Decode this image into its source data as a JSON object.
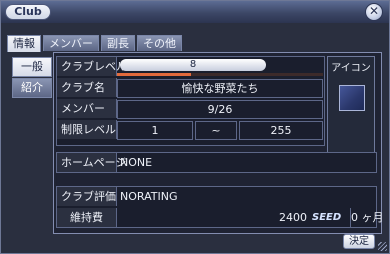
{
  "window": {
    "title": "Club",
    "close_glyph": "✕"
  },
  "tabs": [
    "情報",
    "メンバー",
    "副長",
    "その他"
  ],
  "side_tabs": [
    "一般",
    "紹介"
  ],
  "info": {
    "level_label": "クラブレベル",
    "level_value": "8",
    "xp_progress": 0.36,
    "name_label": "クラブ名",
    "name_value": "愉快な野菜たち",
    "members_label": "メンバー",
    "members_value": "9/26",
    "limit_label": "制限レベル",
    "limit_min": "1",
    "limit_sep": "~",
    "limit_max": "255",
    "homepage_label": "ホームページ",
    "homepage_value": "NONE",
    "rating_label": "クラブ評価",
    "rating_value": "NORATING",
    "upkeep_label": "維持費",
    "upkeep_amount": "2400",
    "upkeep_currency": "SEED",
    "upkeep_months": "0 ヶ月"
  },
  "icon_panel": {
    "label": "アイコン"
  },
  "ok_label": "決定",
  "colors": {
    "xp_bar": "#e26a3c",
    "window_bg": "#2a2f3f"
  }
}
